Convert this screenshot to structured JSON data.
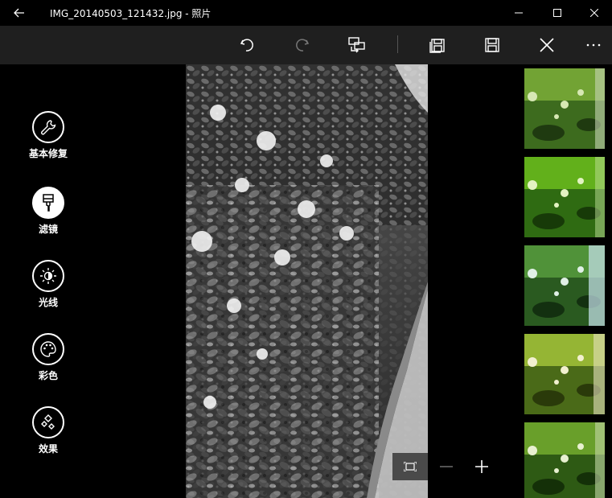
{
  "window": {
    "title": "IMG_20140503_121432.jpg - 照片"
  },
  "toolbar": {
    "buttons": [
      "undo-icon",
      "redo-icon",
      "compare-icon",
      "save-copy-icon",
      "save-icon",
      "close-icon",
      "more-icon"
    ]
  },
  "left_panel": {
    "tools": [
      {
        "label": "基本修复",
        "icon": "wrench-icon",
        "active": false
      },
      {
        "label": "滤镜",
        "icon": "brush-icon",
        "active": true
      },
      {
        "label": "光线",
        "icon": "sun-icon",
        "active": false
      },
      {
        "label": "彩色",
        "icon": "palette-icon",
        "active": false
      },
      {
        "label": "效果",
        "icon": "effects-icon",
        "active": false
      }
    ]
  },
  "filters": {
    "count_visible": 5
  },
  "colors": {
    "titlebar_bg": "#000000",
    "toolbar_bg": "#1f1f1f",
    "app_bg": "#000000",
    "accent": "#ffffff"
  }
}
